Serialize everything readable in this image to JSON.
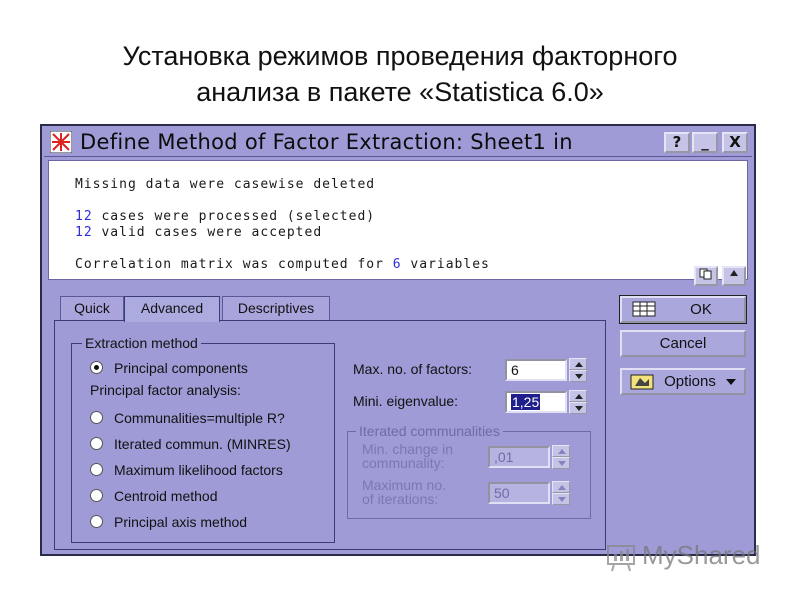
{
  "slide": {
    "title_line1": "Установка режимов проведения факторного",
    "title_line2": "анализа в пакете «Statistica 6.0»"
  },
  "window": {
    "title": "Define Method of Factor Extraction: Sheet1 in",
    "help_glyph": "?",
    "minimize_glyph": "_",
    "close_glyph": "X"
  },
  "output": {
    "line1": "Missing data were casewise deleted",
    "line2_num": "12",
    "line2_text": " cases were processed (selected)",
    "line3_num": "12",
    "line3_text": " valid cases were accepted",
    "line4_pre": "Correlation matrix was computed for ",
    "line4_num": "6",
    "line4_post": " variables"
  },
  "tabs": [
    {
      "label": "Quick",
      "active": false
    },
    {
      "label": "Advanced",
      "active": true
    },
    {
      "label": "Descriptives",
      "active": false
    }
  ],
  "extraction": {
    "legend": "Extraction method",
    "principal_components": "Principal components",
    "pfa_label": "Principal factor analysis:",
    "communalities": "Communalities=multiple R?",
    "iterated": "Iterated commun. (MINRES)",
    "max_likelihood": "Maximum likelihood factors",
    "centroid": "Centroid method",
    "principal_axis": "Principal axis method",
    "selected": "Principal components"
  },
  "fields": {
    "max_factors_label": "Max. no. of factors:",
    "max_factors_value": "6",
    "min_eigen_label": "Mini. eigenvalue:",
    "min_eigen_value": "1,25"
  },
  "iterated": {
    "legend": "Iterated communalities",
    "min_change_label1": "Min. change in",
    "min_change_label2": "communality:",
    "min_change_value": ",01",
    "max_iter_label1": "Maximum no.",
    "max_iter_label2": "of iterations:",
    "max_iter_value": "50"
  },
  "buttons": {
    "ok": "OK",
    "cancel": "Cancel",
    "options": "Options"
  },
  "watermark": "MyShared",
  "colors": {
    "dialog_bg": "#9f9bd6",
    "number_blue": "#2b2bd8"
  }
}
